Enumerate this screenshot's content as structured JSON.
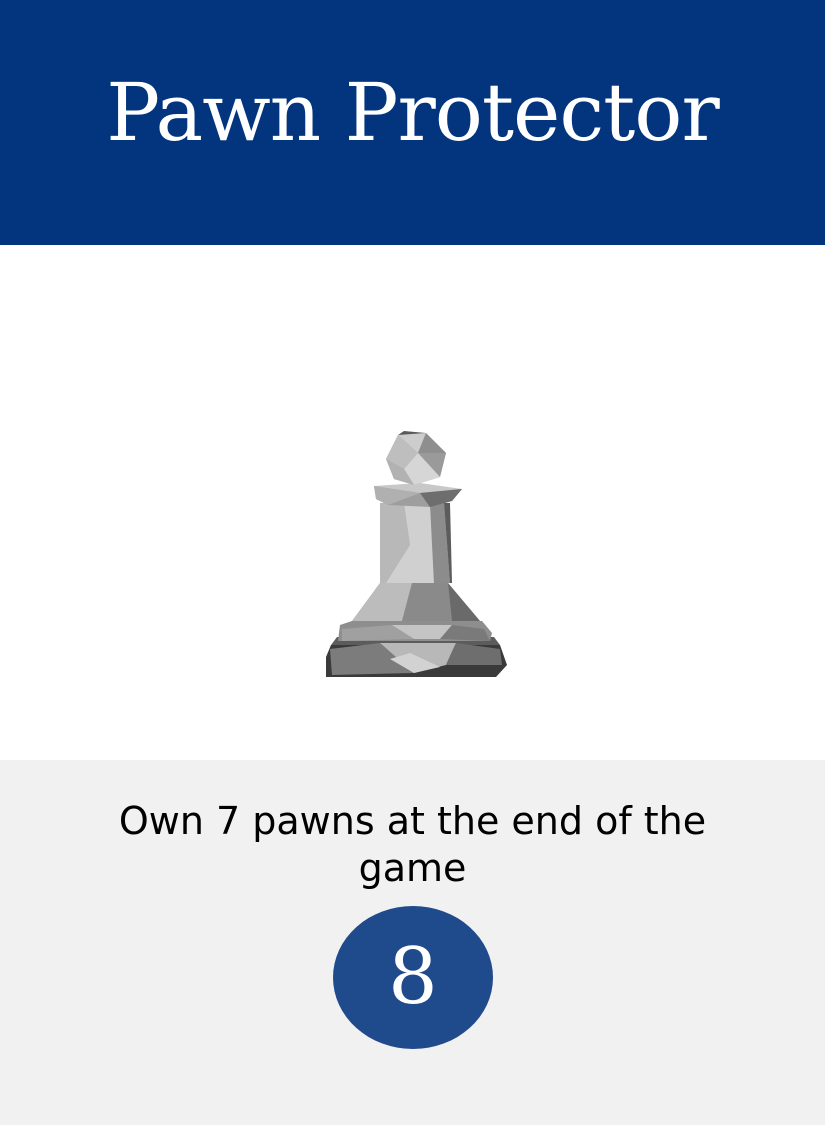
{
  "card": {
    "title": "Pawn Protector",
    "description": "Own 7 pawns at the end of the game",
    "value": "8",
    "image_icon": "chess-pawn-icon"
  },
  "colors": {
    "header_background": "#03357F",
    "footer_background": "#F1F1F1",
    "badge_background": "#1F4A8C",
    "pawn_light": "#C6C6C6",
    "pawn_mid": "#9A9A9A",
    "pawn_dark": "#3C3C3C"
  }
}
